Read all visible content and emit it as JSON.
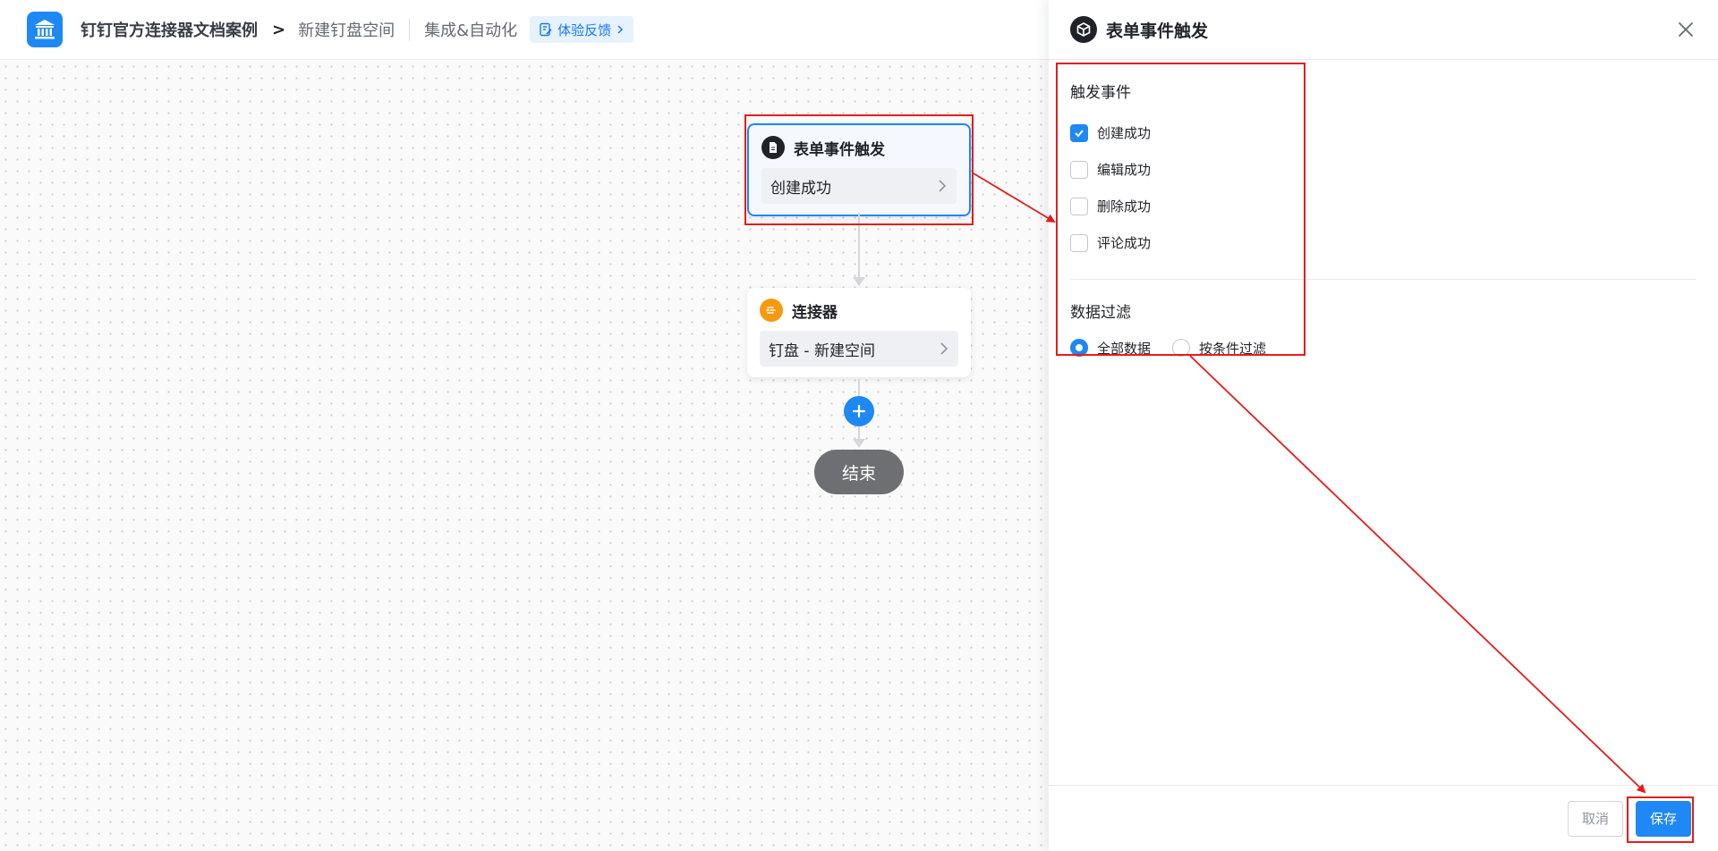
{
  "header": {
    "app_name": "钉钉官方连接器文档案例",
    "separator": ">",
    "page_name": "新建钉盘空间",
    "module": "集成&自动化",
    "feedback_label": "体验反馈"
  },
  "canvas": {
    "trigger_node": {
      "title": "表单事件触发",
      "value": "创建成功"
    },
    "connector_node": {
      "title": "连接器",
      "value": "钉盘 - 新建空间"
    },
    "end_label": "结束"
  },
  "panel": {
    "title": "表单事件触发",
    "trigger_section": {
      "title": "触发事件",
      "options": [
        {
          "label": "创建成功",
          "checked": true
        },
        {
          "label": "编辑成功",
          "checked": false
        },
        {
          "label": "删除成功",
          "checked": false
        },
        {
          "label": "评论成功",
          "checked": false
        }
      ]
    },
    "filter_section": {
      "title": "数据过滤",
      "options": [
        {
          "label": "全部数据",
          "checked": true
        },
        {
          "label": "按条件过滤",
          "checked": false
        }
      ]
    },
    "cancel_label": "取消",
    "save_label": "保存"
  },
  "colors": {
    "primary": "#1e88f5",
    "annotation": "#e51c1c",
    "connector_icon": "#f59a0f"
  }
}
